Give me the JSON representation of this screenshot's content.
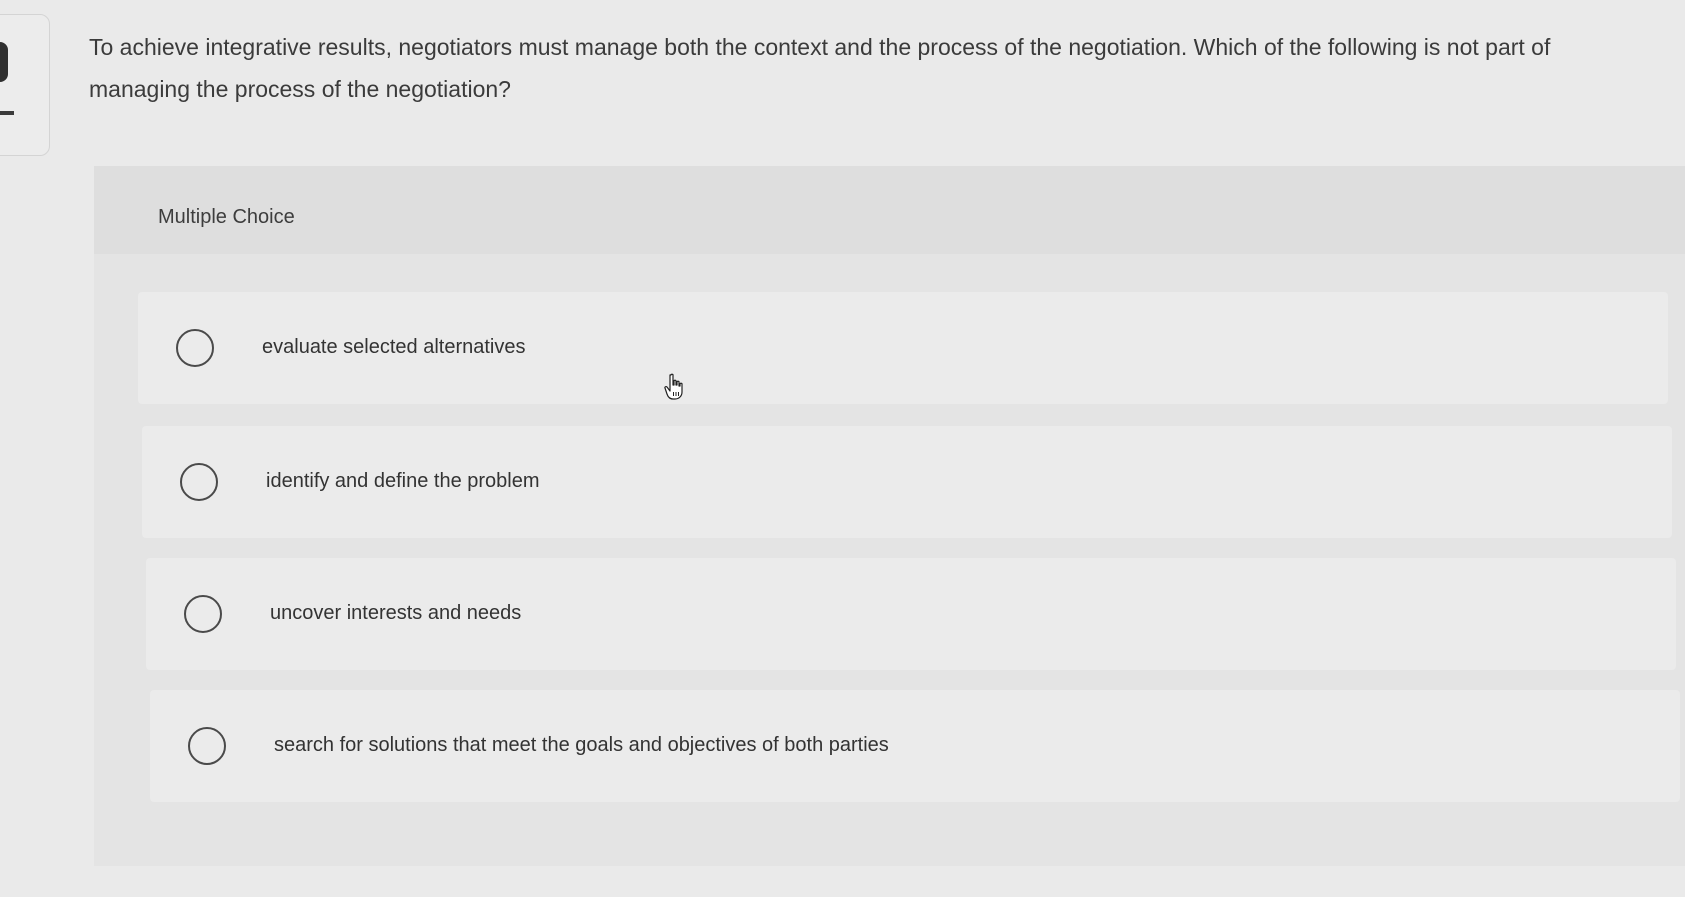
{
  "question": {
    "text": "To achieve integrative results, negotiators must manage both the context and the process of the negotiation. Which of the following is not part of managing the process of the negotiation?"
  },
  "panel": {
    "label": "Multiple Choice"
  },
  "choices": [
    {
      "label": "evaluate selected alternatives",
      "selected": false
    },
    {
      "label": "identify and define the problem",
      "selected": false
    },
    {
      "label": "uncover interests and needs",
      "selected": false
    },
    {
      "label": "search for solutions that meet the goals and objectives of both parties",
      "selected": false
    }
  ],
  "icons": {
    "cursor": "hand-pointer-icon"
  }
}
